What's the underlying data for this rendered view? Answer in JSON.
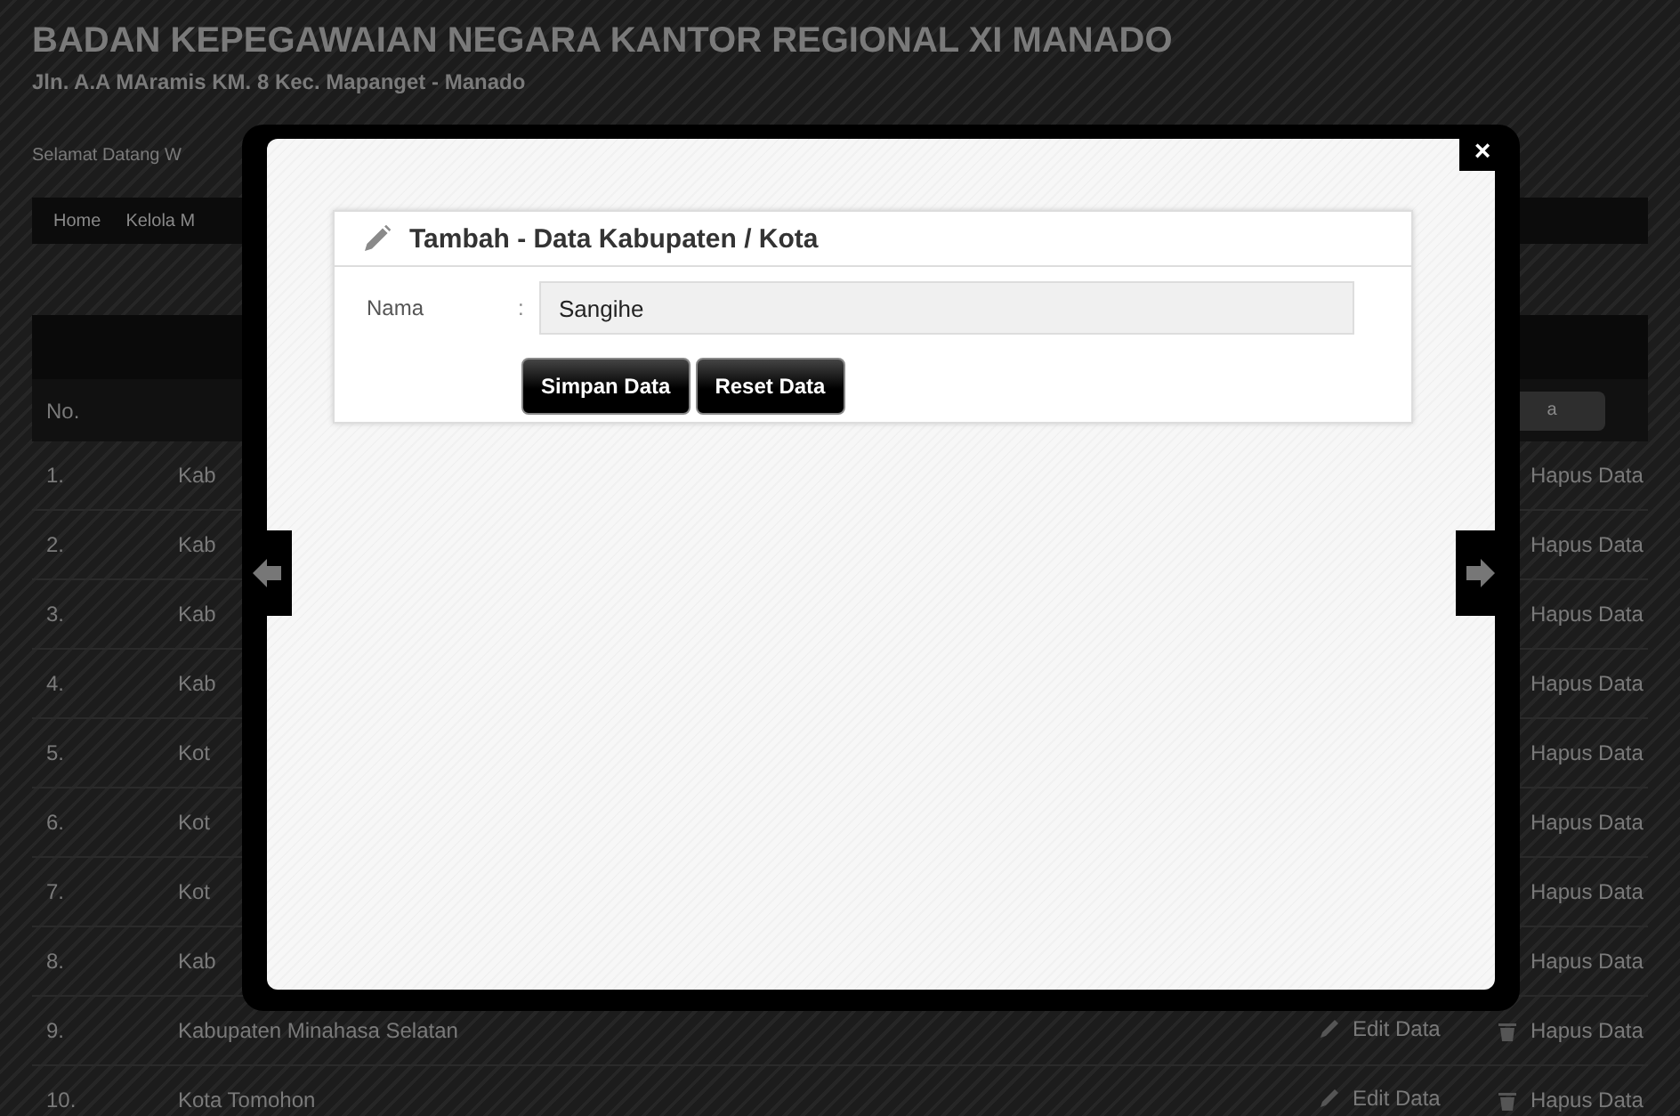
{
  "header": {
    "title": "BADAN KEPEGAWAIAN NEGARA KANTOR REGIONAL XI MANADO",
    "address": "Jln. A.A MAramis KM. 8 Kec. Mapanget - Manado",
    "welcome": "Selamat Datang W"
  },
  "nav": [
    "Home",
    "Kelola M"
  ],
  "table": {
    "header_no": "No.",
    "header_action": "a",
    "rows": [
      {
        "no": "1.",
        "name": "Kab",
        "edit": "",
        "hapus": "Hapus Data"
      },
      {
        "no": "2.",
        "name": "Kab",
        "edit": "",
        "hapus": "Hapus Data"
      },
      {
        "no": "3.",
        "name": "Kab",
        "edit": "",
        "hapus": "Hapus Data"
      },
      {
        "no": "4.",
        "name": "Kab",
        "edit": "",
        "hapus": "Hapus Data"
      },
      {
        "no": "5.",
        "name": "Kot",
        "edit": "",
        "hapus": "Hapus Data"
      },
      {
        "no": "6.",
        "name": "Kot",
        "edit": "",
        "hapus": "Hapus Data"
      },
      {
        "no": "7.",
        "name": "Kot",
        "edit": "",
        "hapus": "Hapus Data"
      },
      {
        "no": "8.",
        "name": "Kab",
        "edit": "",
        "hapus": "Hapus Data"
      },
      {
        "no": "9.",
        "name": "Kabupaten Minahasa Selatan",
        "edit": "Edit Data",
        "hapus": "Hapus Data"
      },
      {
        "no": "10.",
        "name": "Kota Tomohon",
        "edit": "Edit Data",
        "hapus": "Hapus Data"
      }
    ]
  },
  "modal": {
    "form_title": "Tambah - Data Kabupaten / Kota",
    "field_label": "Nama",
    "colon": ":",
    "field_value": "Sangihe",
    "buttons": [
      "Simpan Data",
      "Reset Data"
    ],
    "close": "×"
  }
}
